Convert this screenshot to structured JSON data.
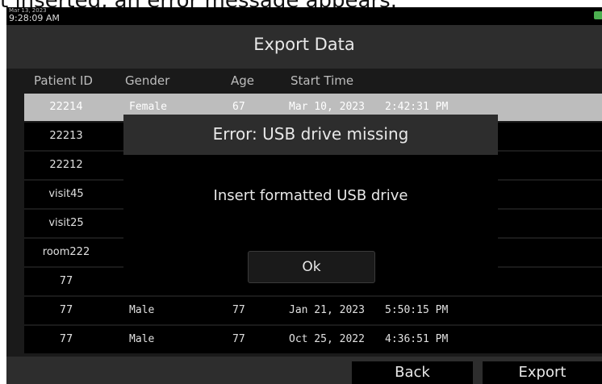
{
  "caption": "t inserted, an error message appears.",
  "status": {
    "date": "Mar 13, 2023",
    "time": "9:28:09 AM",
    "battery_icon": "battery-charging-icon",
    "battery_color": "#4caf50"
  },
  "header": {
    "title": "Export Data"
  },
  "columns": [
    "Patient ID",
    "Gender",
    "Age",
    "Start Time"
  ],
  "rows": [
    {
      "id": "22214",
      "gender": "Female",
      "age": "67",
      "start": "Mar 10, 2023",
      "time": "2:42:31 PM"
    },
    {
      "id": "22213",
      "gender": "",
      "age": "",
      "start": "",
      "time": ""
    },
    {
      "id": "22212",
      "gender": "",
      "age": "",
      "start": "",
      "time": ""
    },
    {
      "id": "visit45",
      "gender": "",
      "age": "",
      "start": "",
      "time": ""
    },
    {
      "id": "visit25",
      "gender": "",
      "age": "",
      "start": "",
      "time": ""
    },
    {
      "id": "room222",
      "gender": "",
      "age": "",
      "start": "",
      "time": ""
    },
    {
      "id": "77",
      "gender": "",
      "age": "",
      "start": "",
      "time": ""
    },
    {
      "id": "77",
      "gender": "Male",
      "age": "77",
      "start": "Jan 21, 2023",
      "time": "5:50:15 PM"
    },
    {
      "id": "77",
      "gender": "Male",
      "age": "77",
      "start": "Oct 25, 2022",
      "time": "4:36:51 PM"
    }
  ],
  "dialog": {
    "title": "Error: USB drive missing",
    "message": "Insert formatted USB drive",
    "ok_label": "Ok"
  },
  "footer": {
    "back_label": "Back",
    "export_label": "Export"
  },
  "colors": {
    "selected_row": "#bdbdbd",
    "panel": "#2d2d2d",
    "row": "#000000"
  }
}
